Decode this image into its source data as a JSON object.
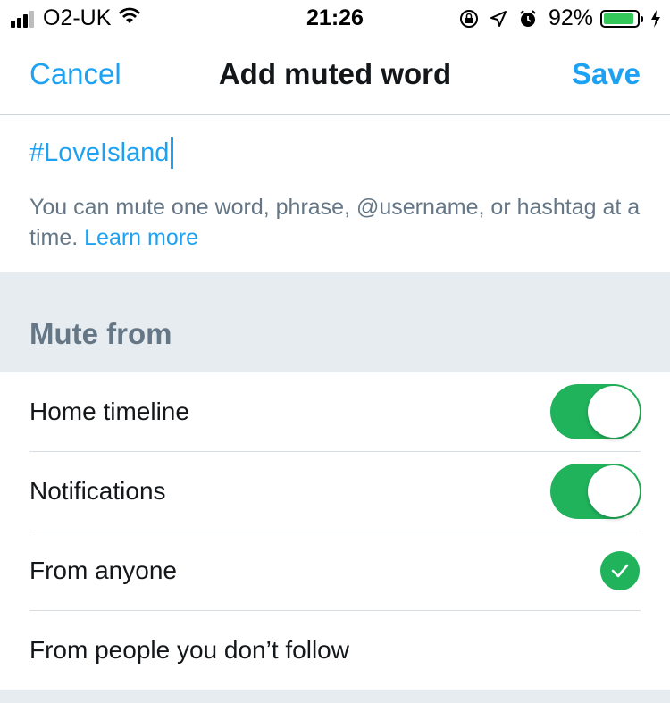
{
  "status_bar": {
    "carrier": "O2-UK",
    "time": "21:26",
    "battery_percent": "92%",
    "battery_level": 0.92,
    "icons": [
      "signal-icon",
      "wifi-icon",
      "orientation-lock-icon",
      "location-icon",
      "alarm-icon",
      "battery-icon",
      "charging-icon"
    ]
  },
  "nav": {
    "cancel_label": "Cancel",
    "title": "Add muted word",
    "save_label": "Save"
  },
  "input": {
    "value": "#LoveIsland",
    "help_text": "You can mute one word, phrase, @username, or hashtag at a time.",
    "help_link": "Learn more"
  },
  "mute_from": {
    "header": "Mute from",
    "rows": [
      {
        "label": "Home timeline",
        "control": "toggle",
        "on": true
      },
      {
        "label": "Notifications",
        "control": "toggle",
        "on": true
      },
      {
        "label": "From anyone",
        "control": "check",
        "selected": true
      },
      {
        "label": "From people you don’t follow",
        "control": "check",
        "selected": false
      }
    ]
  },
  "colors": {
    "accent": "#1da1f2",
    "toggle_on": "#21b35b",
    "section_bg": "#e6ecf0",
    "muted_text": "#657786"
  }
}
